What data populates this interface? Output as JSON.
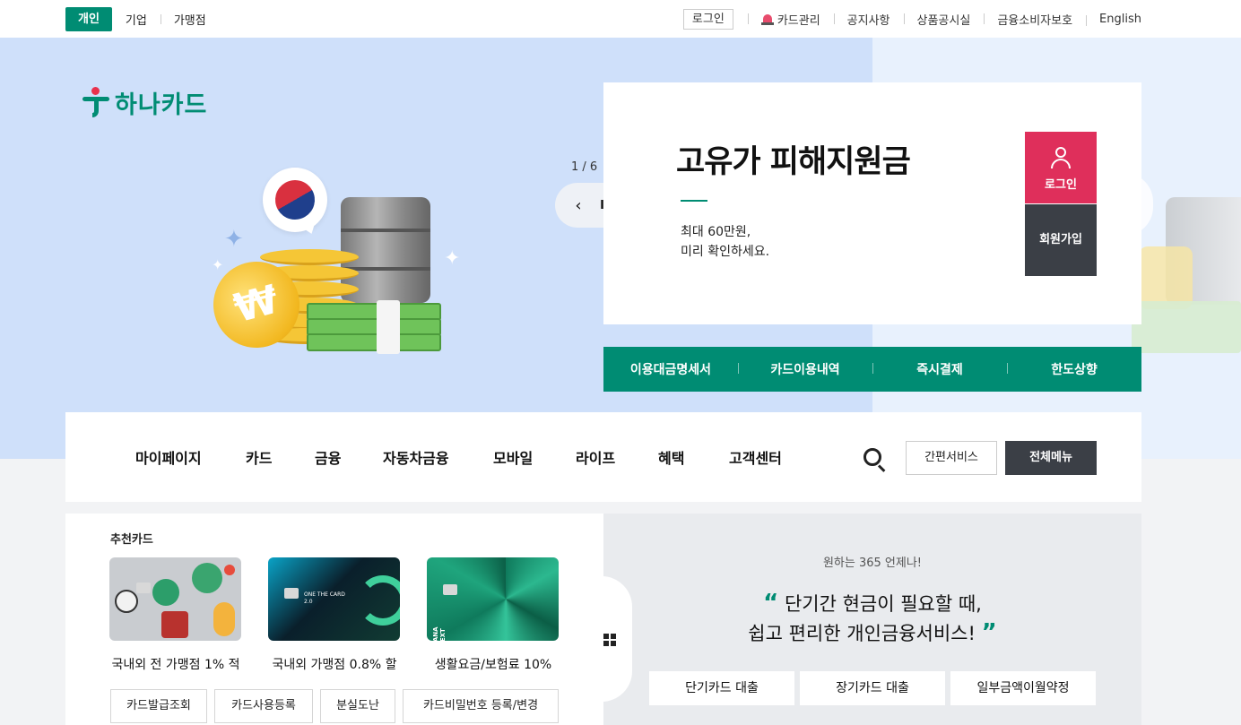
{
  "topbar": {
    "segments": [
      "개인",
      "기업",
      "가맹점"
    ],
    "login": "로그인",
    "links": [
      "카드관리",
      "공지사항",
      "상품공시실",
      "금융소비자보호",
      "English"
    ]
  },
  "brand": {
    "logo_text": "하나카드",
    "green": "#008c73",
    "pink": "#df2f5b",
    "dark": "#3b3f46"
  },
  "hero": {
    "counter": "1 / 6",
    "title": "고유가 피해지원금",
    "desc_line1": "최대 60만원,",
    "desc_line2": "미리 확인하세요.",
    "login_tile": "로그인",
    "join_tile": "회원가입",
    "coin_symbol": "₩",
    "quick_links": [
      "이용대금명세서",
      "카드이용내역",
      "즉시결제",
      "한도상향"
    ]
  },
  "nav": {
    "items": [
      "마이페이지",
      "카드",
      "금융",
      "자동차금융",
      "모바일",
      "라이프",
      "혜택",
      "고객센터"
    ],
    "easy_service": "간편서비스",
    "all_menu": "전체메뉴"
  },
  "recommended": {
    "title": "추천카드",
    "cards": [
      {
        "label": "국내외 전 가맹점 1% 적",
        "card_text": ""
      },
      {
        "label": "국내외 가맹점 0.8% 할",
        "card_text": "ONE THE CARD 2.0"
      },
      {
        "label": "생활요금/보험료 10%",
        "card_text": "HANA NEXT"
      }
    ],
    "buttons": [
      "카드발급조회",
      "카드사용등록",
      "분실도난",
      "카드비밀번호 등록/변경"
    ]
  },
  "loan": {
    "subtitle": "원하는 365 언제나!",
    "line1": "단기간 현금이 필요할 때,",
    "line2": "쉽고 편리한 개인금융서비스!",
    "buttons": [
      "단기카드 대출",
      "장기카드 대출",
      "일부금액이월약정"
    ]
  }
}
